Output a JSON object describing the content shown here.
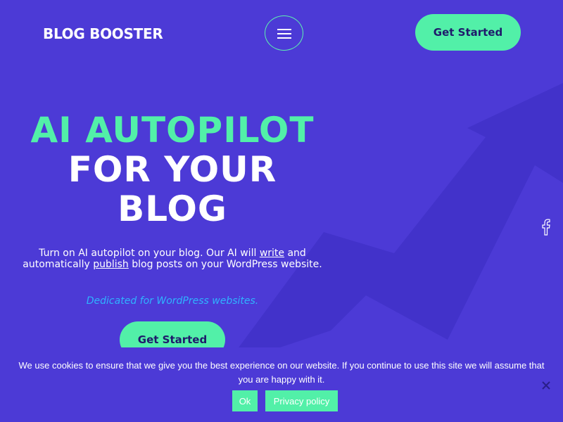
{
  "header": {
    "logo": "BLOG BOOSTER",
    "menu_icon": "hamburger-menu-icon",
    "cta_label": "Get Started"
  },
  "hero": {
    "line1": "AI AUTOPILOT",
    "line2": "FOR YOUR",
    "line3": "BLOG",
    "desc_part1": "Turn on AI autopilot on your blog. Our AI will ",
    "desc_link1": "write",
    "desc_part2": " and automatically ",
    "desc_link2": "publish",
    "desc_part3": " blog posts on your WordPress website.",
    "tagline": "Dedicated for WordPress websites.",
    "cta_label": "Get Started"
  },
  "social": {
    "facebook_icon": "facebook-icon"
  },
  "cookie": {
    "text": "We use cookies to ensure that we give you the best experience on our website. If you continue to use this site we will assume that you are happy with it.",
    "ok_label": "Ok",
    "policy_label": "Privacy policy",
    "close_icon": "close-icon"
  },
  "colors": {
    "background": "#4c3ad6",
    "accent": "#52f0a8",
    "tagline": "#2fb3ff",
    "arrow_shape": "#3f2fc4"
  }
}
